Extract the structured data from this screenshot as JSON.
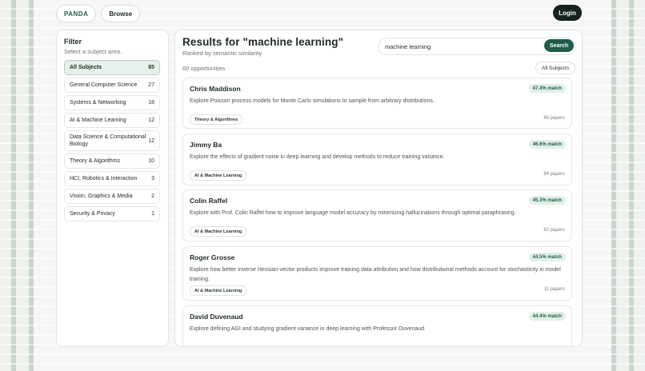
{
  "nav": {
    "brand": "PANDA",
    "browse": "Browse",
    "login": "Login"
  },
  "filter": {
    "title": "Filter",
    "subtitle": "Select a subject area.",
    "items": [
      {
        "label": "All Subjects",
        "count": "85",
        "active": true
      },
      {
        "label": "General Computer Science",
        "count": "27"
      },
      {
        "label": "Systems & Networking",
        "count": "18"
      },
      {
        "label": "AI & Machine Learning",
        "count": "12"
      },
      {
        "label": "Data Science & Computational Biology",
        "count": "12"
      },
      {
        "label": "Theory & Algorithms",
        "count": "10"
      },
      {
        "label": "HCI, Robotics & Interaction",
        "count": "3"
      },
      {
        "label": "Vision, Graphics & Media",
        "count": "2"
      },
      {
        "label": "Security & Privacy",
        "count": "1"
      }
    ]
  },
  "results": {
    "title": "Results for \"machine learning\"",
    "subtitle": "Ranked by semantic similarity",
    "count": "60 opportunities",
    "subject_filter": "All Subjects",
    "search": {
      "value": "machine learning",
      "button": "Search"
    },
    "cards": [
      {
        "name": "Chris Maddison",
        "match": "47.4% match",
        "desc": "Explore Poisson process models for Monte Carlo simulations to sample from arbitrary distributions.",
        "tag": "Theory & Algorithms",
        "papers": "66 papers"
      },
      {
        "name": "Jimmy Ba",
        "match": "46.6% match",
        "desc": "Explore the effects of gradient noise in deep learning and develop methods to reduce training variance.",
        "tag": "AI & Machine Learning",
        "papers": "84 papers"
      },
      {
        "name": "Colin Raffel",
        "match": "45.3% match",
        "desc": "Explore with Prof. Colin Raffel how to improve language model accuracy by minimizing hallucinations through optimal paraphrasing.",
        "tag": "AI & Machine Learning",
        "papers": "62 papers"
      },
      {
        "name": "Roger Grosse",
        "match": "44.5% match",
        "desc": "Explore how better inverse Hessian-vector products improve training data attribution and how distributional methods account for stochasticity in model training.",
        "tag": "AI & Machine Learning",
        "papers": "11 papers"
      },
      {
        "name": "David Duvenaud",
        "match": "44.4% match",
        "desc": "Explore defining AGI and studying gradient variance in deep learning with Professor Duvenaud.",
        "tag": "",
        "papers": ""
      }
    ]
  },
  "colors": {
    "accent": "#1f5c4a",
    "dark": "#16231d",
    "match_bg": "#e2efe6"
  }
}
